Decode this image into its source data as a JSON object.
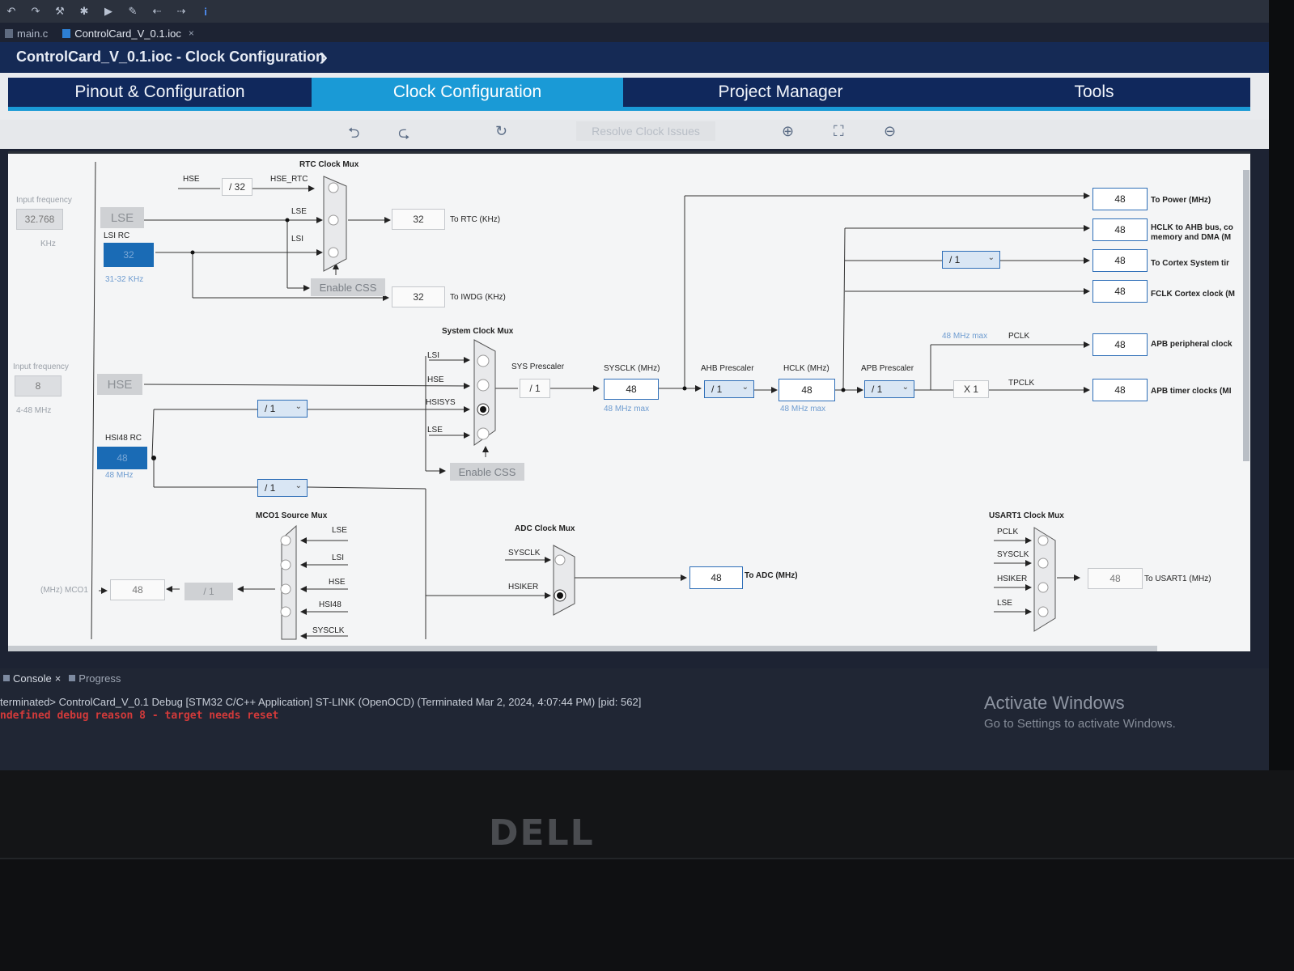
{
  "toolbar": {
    "icons": [
      "undo-icon",
      "redo-icon",
      "build-icon",
      "debug-icon",
      "run-icon",
      "tool-icon",
      "back-icon",
      "forward-icon",
      "info-icon"
    ]
  },
  "editor_tabs": [
    {
      "label": "main.c"
    },
    {
      "label": "ControlCard_V_0.1.ioc",
      "close": "×"
    }
  ],
  "breadcrumb": {
    "title": "ControlCard_V_0.1.ioc - Clock Configuration"
  },
  "main_tabs": [
    {
      "label": "Pinout & Configuration"
    },
    {
      "label": "Clock Configuration"
    },
    {
      "label": "Project Manager"
    },
    {
      "label": "Tools"
    }
  ],
  "diagram_tools": {
    "resolve": "Resolve Clock Issues"
  },
  "diagram": {
    "rtc_mux": "RTC Clock Mux",
    "hse": "HSE",
    "div32": "/ 32",
    "hse_rtc": "HSE_RTC",
    "input_freq": "Input frequency",
    "lse_freq": "32.768",
    "khz": "KHz",
    "lse": "LSE",
    "lsi_rc": "LSI RC",
    "lsi_val": "32",
    "lsi_range": "31-32 KHz",
    "lsi": "LSI",
    "enable_css": "Enable CSS",
    "rtc_val": "32",
    "to_rtc": "To RTC (KHz)",
    "iwdg_val": "32",
    "to_iwdg": "To IWDG (KHz)",
    "sys_mux": "System Clock Mux",
    "input_freq2": "Input frequency",
    "hse_freq": "8",
    "hse_range": "4-48 MHz",
    "hsisys": "HSISYS",
    "div1": "/ 1",
    "hsi48_rc": "HSI48 RC",
    "hsi48_val": "48",
    "hsi48_range": "48 MHz",
    "sys_presc": "SYS Prescaler",
    "sysclk_lbl": "SYSCLK (MHz)",
    "sysclk_val": "48",
    "sysclk_max": "48 MHz max",
    "ahb_presc": "AHB Prescaler",
    "hclk_lbl": "HCLK (MHz)",
    "hclk_val": "48",
    "hclk_max": "48 MHz max",
    "apb_presc": "APB Prescaler",
    "pclk_max": "48 MHz max",
    "pclk": "PCLK",
    "tpclk": "TPCLK",
    "x1": "X 1",
    "out_power_val": "48",
    "out_power": "To Power (MHz)",
    "out_hclk_val": "48",
    "out_hclk": "HCLK to AHB bus, co",
    "out_hclk2": "memory and DMA (M",
    "out_cortex_val": "48",
    "out_cortex": "To Cortex System tir",
    "out_fclk_val": "48",
    "out_fclk": "FCLK Cortex clock (M",
    "out_apb_val": "48",
    "out_apb": "APB peripheral clock",
    "out_tim_val": "48",
    "out_tim": "APB timer clocks (MI",
    "mco_mux": "MCO1 Source Mux",
    "hsi48": "HSI48",
    "sysclk": "SYSCLK",
    "mco_out": "(MHz) MCO1",
    "mco_val": "48",
    "adc_mux": "ADC Clock Mux",
    "hsiker": "HSIKER",
    "adc_val": "48",
    "to_adc": "To ADC (MHz)",
    "usart_mux": "USART1 Clock Mux",
    "usart_val": "48",
    "to_usart": "To USART1 (MHz)"
  },
  "console": {
    "tab_console": "Console",
    "tab_progress": "Progress",
    "line1": "terminated> ControlCard_V_0.1 Debug [STM32 C/C++ Application] ST-LINK (OpenOCD) (Terminated Mar 2, 2024, 4:07:44 PM) [pid: 562]",
    "line2": "ndefined debug reason 8 - target needs reset",
    "activate_title": "Activate Windows",
    "activate_sub": "Go to Settings to activate Windows."
  },
  "bezel": {
    "brand": "DELL"
  }
}
